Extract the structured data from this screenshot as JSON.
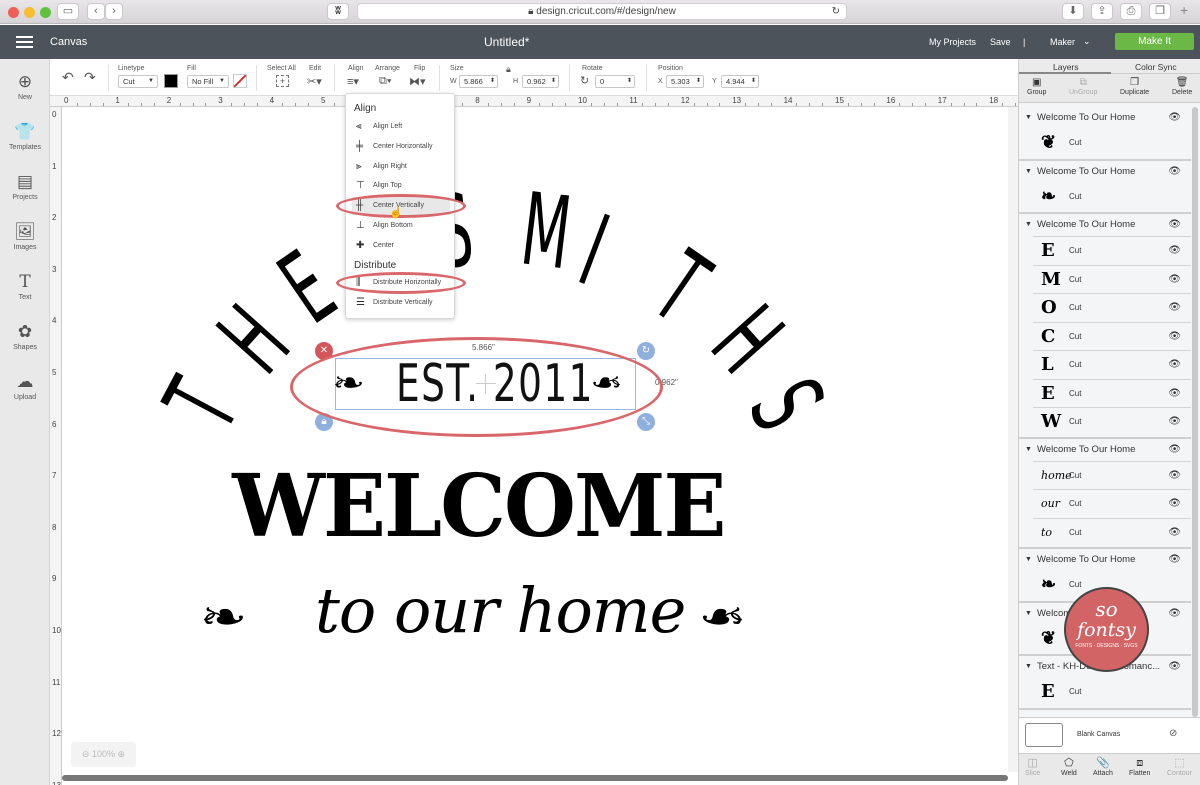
{
  "browser": {
    "url": "design.cricut.com/#/design/new",
    "back_icon": "‹",
    "forward_icon": "›"
  },
  "app": {
    "section": "Canvas",
    "doc_title": "Untitled*",
    "my_projects": "My Projects",
    "save": "Save",
    "divider": "|",
    "machine": "Maker",
    "make_it": "Make It"
  },
  "toolbar": {
    "linetype_label": "Linetype",
    "linetype_value": "Cut",
    "fill_label": "Fill",
    "fill_value": "No Fill",
    "select_all": "Select All",
    "edit": "Edit",
    "align": "Align",
    "arrange": "Arrange",
    "flip": "Flip",
    "size_label": "Size",
    "w_label": "W",
    "w_value": "5.866",
    "h_label": "H",
    "h_value": "0.962",
    "rotate_label": "Rotate",
    "rotate_value": "0",
    "position_label": "Position",
    "x_label": "X",
    "x_value": "5.303",
    "y_label": "Y",
    "y_value": "4.944",
    "line_color": "#000000"
  },
  "sidebar": {
    "items": [
      {
        "label": "New",
        "icon": "⊕"
      },
      {
        "label": "Templates",
        "icon": "👕"
      },
      {
        "label": "Projects",
        "icon": "▤"
      },
      {
        "label": "Images",
        "icon": "🖼"
      },
      {
        "label": "Text",
        "icon": "T"
      },
      {
        "label": "Shapes",
        "icon": "✿"
      },
      {
        "label": "Upload",
        "icon": "☁"
      }
    ]
  },
  "rulers": {
    "h": [
      "0",
      "1",
      "2",
      "3",
      "4",
      "5",
      "6",
      "7",
      "8",
      "9",
      "10",
      "11",
      "12",
      "13",
      "14",
      "15",
      "16",
      "17",
      "18"
    ],
    "v": [
      "0",
      "1",
      "2",
      "3",
      "4",
      "5",
      "6",
      "7",
      "8",
      "9",
      "10",
      "11",
      "12",
      "13"
    ]
  },
  "align_menu": {
    "align_heading": "Align",
    "align_items": [
      {
        "label": "Align Left",
        "icon": "⫷"
      },
      {
        "label": "Center Horizontally",
        "icon": "╪"
      },
      {
        "label": "Align Right",
        "icon": "⫸"
      },
      {
        "label": "Align Top",
        "icon": "⊤"
      },
      {
        "label": "Center Vertically",
        "icon": "╫"
      },
      {
        "label": "Align Bottom",
        "icon": "⊥"
      },
      {
        "label": "Center",
        "icon": "✚"
      }
    ],
    "distribute_heading": "Distribute",
    "distribute_items": [
      {
        "label": "Distribute Horizontally",
        "icon": "⫼"
      },
      {
        "label": "Distribute Vertically",
        "icon": "☰"
      }
    ]
  },
  "design": {
    "arch_text": "THE SMITHS",
    "est_text": "EST. 2011",
    "welcome_text": "WELCOME",
    "home_text": "to our home",
    "width_readout": "5.866\"",
    "height_readout": "0.962\""
  },
  "canvas": {
    "zoom": "100%"
  },
  "layers_panel": {
    "tabs": [
      "Layers",
      "Color Sync"
    ],
    "actions": [
      {
        "label": "Group",
        "icon": "▣",
        "enabled": true
      },
      {
        "label": "UnGroup",
        "icon": "⧉",
        "enabled": false
      },
      {
        "label": "Duplicate",
        "icon": "❐",
        "enabled": true
      },
      {
        "label": "Delete",
        "icon": "🗑",
        "enabled": true
      }
    ],
    "groups": [
      {
        "name": "Welcome To Our Home",
        "rows": [
          {
            "thumb": "❦",
            "type": "Cut"
          }
        ]
      },
      {
        "name": "Welcome To Our Home",
        "rows": [
          {
            "thumb": "❧",
            "type": "Cut"
          }
        ]
      },
      {
        "name": "Welcome To Our Home",
        "rows": [
          {
            "thumb": "E",
            "type": "Cut"
          },
          {
            "thumb": "M",
            "type": "Cut"
          },
          {
            "thumb": "O",
            "type": "Cut"
          },
          {
            "thumb": "C",
            "type": "Cut"
          },
          {
            "thumb": "L",
            "type": "Cut"
          },
          {
            "thumb": "E",
            "type": "Cut"
          },
          {
            "thumb": "W",
            "type": "Cut"
          }
        ]
      },
      {
        "name": "Welcome To Our Home",
        "rows": [
          {
            "thumb": "home",
            "type": "Cut"
          },
          {
            "thumb": "our",
            "type": "Cut"
          },
          {
            "thumb": "to",
            "type": "Cut"
          }
        ]
      },
      {
        "name": "Welcome To Our Home",
        "rows": [
          {
            "thumb": "❧",
            "type": "Cut"
          }
        ]
      },
      {
        "name": "Welcome To Our Home",
        "rows": [
          {
            "thumb": "❦",
            "type": "Cut"
          }
        ]
      },
      {
        "name": "Text - KH-Delicate-Romanc...",
        "rows": [
          {
            "thumb": "E",
            "type": "Cut"
          }
        ]
      }
    ],
    "blank_canvas": "Blank Canvas",
    "bottom_actions": [
      {
        "label": "Slice",
        "icon": "◫",
        "enabled": false
      },
      {
        "label": "Weld",
        "icon": "⬠",
        "enabled": true
      },
      {
        "label": "Attach",
        "icon": "📎",
        "enabled": true
      },
      {
        "label": "Flatten",
        "icon": "⧈",
        "enabled": true
      },
      {
        "label": "Contour",
        "icon": "⬚",
        "enabled": false
      }
    ]
  },
  "watermark": {
    "line1": "so",
    "line2": "fontsy",
    "tagline": "FONTS · DESIGNS · SVGS"
  }
}
